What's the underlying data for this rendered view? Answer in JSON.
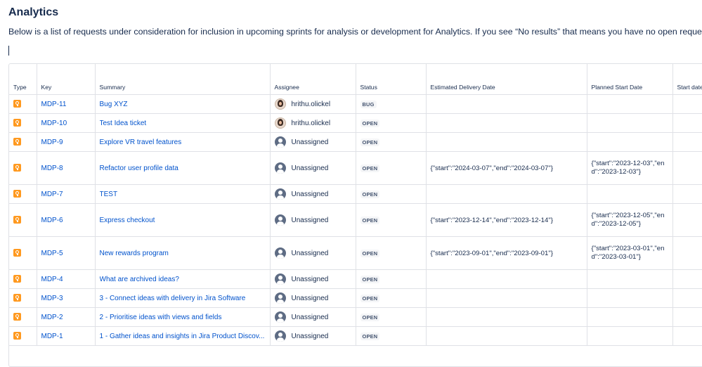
{
  "page": {
    "title": "Analytics",
    "intro": "Below is a list of requests under consideration for inclusion in upcoming sprints for analysis or development for Analytics. If you see “No results” that means you have no open requests :"
  },
  "table": {
    "headers": {
      "type": "Type",
      "key": "Key",
      "summary": "Summary",
      "assignee": "Assignee",
      "status": "Status",
      "estimated": "Estimated Delivery Date",
      "planned": "Planned Start Date",
      "start": "Start date"
    },
    "rows": [
      {
        "key": "MDP-11",
        "summary": "Bug XYZ",
        "assignee": "hrithu.olickel",
        "avatar": "photo",
        "status": "BUG",
        "estimated": "",
        "planned": ""
      },
      {
        "key": "MDP-10",
        "summary": "Test Idea ticket",
        "assignee": "hrithu.olickel",
        "avatar": "photo",
        "status": "OPEN",
        "estimated": "",
        "planned": ""
      },
      {
        "key": "MDP-9",
        "summary": "Explore VR travel features",
        "assignee": "Unassigned",
        "avatar": "default",
        "status": "OPEN",
        "estimated": "",
        "planned": ""
      },
      {
        "key": "MDP-8",
        "summary": "Refactor user profile data",
        "assignee": "Unassigned",
        "avatar": "default",
        "status": "OPEN",
        "estimated": "{\"start\":\"2024-03-07\",\"end\":\"2024-03-07\"}",
        "planned": "{\"start\":\"2023-12-03\",\"end\":\"2023-12-03\"}"
      },
      {
        "key": "MDP-7",
        "summary": "TEST",
        "assignee": "Unassigned",
        "avatar": "default",
        "status": "OPEN",
        "estimated": "",
        "planned": ""
      },
      {
        "key": "MDP-6",
        "summary": "Express checkout",
        "assignee": "Unassigned",
        "avatar": "default",
        "status": "OPEN",
        "estimated": "{\"start\":\"2023-12-14\",\"end\":\"2023-12-14\"}",
        "planned": "{\"start\":\"2023-12-05\",\"end\":\"2023-12-05\"}"
      },
      {
        "key": "MDP-5",
        "summary": "New rewards program",
        "assignee": "Unassigned",
        "avatar": "default",
        "status": "OPEN",
        "estimated": "{\"start\":\"2023-09-01\",\"end\":\"2023-09-01\"}",
        "planned": "{\"start\":\"2023-03-01\",\"end\":\"2023-03-01\"}"
      },
      {
        "key": "MDP-4",
        "summary": "What are archived ideas?",
        "assignee": "Unassigned",
        "avatar": "default",
        "status": "OPEN",
        "estimated": "",
        "planned": ""
      },
      {
        "key": "MDP-3",
        "summary": "3 - Connect ideas with delivery in Jira Software",
        "assignee": "Unassigned",
        "avatar": "default",
        "status": "OPEN",
        "estimated": "",
        "planned": ""
      },
      {
        "key": "MDP-2",
        "summary": "2 - Prioritise ideas with views and fields",
        "assignee": "Unassigned",
        "avatar": "default",
        "status": "OPEN",
        "estimated": "",
        "planned": ""
      },
      {
        "key": "MDP-1",
        "summary": "1 - Gather ideas and insights in Jira Product Discov...",
        "assignee": "Unassigned",
        "avatar": "default",
        "status": "OPEN",
        "estimated": "",
        "planned": ""
      }
    ]
  },
  "icons": {
    "type_icon": "idea-lightbulb-icon",
    "type_color": "#ff991f",
    "link_color": "#0052cc"
  }
}
